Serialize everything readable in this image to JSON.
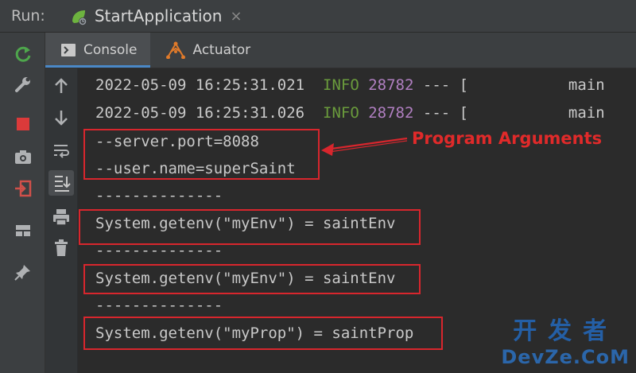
{
  "run_bar": {
    "label": "Run:",
    "tab_title": "StartApplication",
    "close_glyph": "×"
  },
  "sub_tabs": [
    {
      "label": "Console",
      "icon": "console-icon",
      "active": true
    },
    {
      "label": "Actuator",
      "icon": "actuator-icon",
      "active": false
    }
  ],
  "left_toolbar_icons": [
    "rerun-icon",
    "wrench-icon",
    "stop-icon",
    "camera-icon",
    "exit-icon",
    "layout-icon",
    "pin-icon"
  ],
  "console_toolbar_icons": [
    "arrow-up-icon",
    "arrow-down-icon",
    "soft-wrap-icon",
    "scroll-to-end-icon",
    "print-icon",
    "trash-icon"
  ],
  "console": {
    "log_lines": [
      {
        "timestamp": "2022-05-09 16:25:31.021",
        "level": "INFO",
        "pid": "28782",
        "sep": "--- [",
        "thread": "main"
      },
      {
        "timestamp": "2022-05-09 16:25:31.026",
        "level": "INFO",
        "pid": "28782",
        "sep": "--- [",
        "thread": "main"
      }
    ],
    "args": [
      "--server.port=8088",
      "--user.name=superSaint"
    ],
    "divider": "--------------",
    "outputs": [
      "System.getenv(\"myEnv\") = saintEnv",
      "System.getenv(\"myEnv\") = saintEnv",
      "System.getenv(\"myProp\") = saintProp"
    ]
  },
  "annotation": "Program Arguments",
  "watermark": {
    "line1": "开发者",
    "line2": "DevZe.CoM"
  },
  "colors": {
    "info": "#6a9b3c",
    "pid": "#b07fc1",
    "annotation_red": "#d8262d",
    "accent_blue": "#4a88c7"
  }
}
